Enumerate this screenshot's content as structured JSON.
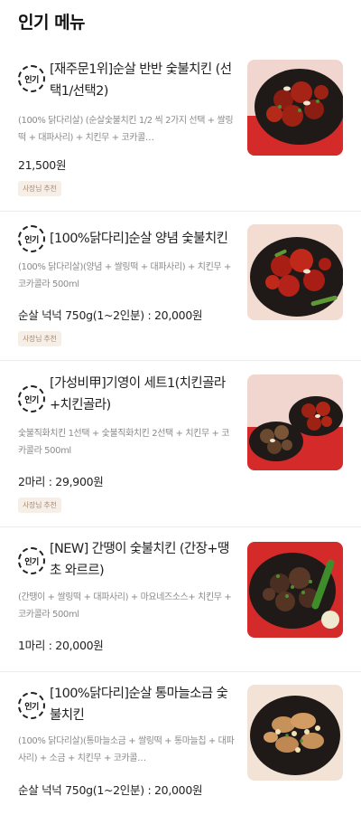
{
  "section": {
    "title": "인기 메뉴"
  },
  "items": [
    {
      "badge": "인기",
      "name": "[재주문1위]순살 반반 숯불치킨 (선택1/선택2)",
      "description": "(100% 닭다리살) (순살숯불치킨 1/2 씩 2가지 선택 + 쌀링떡 + 대파사리) + 치킨무 + 코카콜…",
      "price": "21,500원",
      "tag": "사장님 추천",
      "image_icon": "chicken-platter-red-icon"
    },
    {
      "badge": "인기",
      "name": "[100%닭다리]순살 양념 숯불치킨",
      "description": "(100% 닭다리살)(양념 + 쌀링떡 + 대파사리) + 치킨무 + 코카콜라 500ml",
      "price": "순살 넉넉 750g(1~2인분) : 20,000원",
      "tag": "사장님 추천",
      "image_icon": "spicy-chicken-icon"
    },
    {
      "badge": "인기",
      "name": "[가성비甲]기영이 세트1(치킨골라+치킨골라)",
      "description": "숯불직화치킨 1선택 + 숯불직화치킨 2선택 + 치킨무 + 코카콜라 500ml",
      "price": "2마리 : 29,900원",
      "tag": "사장님 추천",
      "image_icon": "chicken-set-icon"
    },
    {
      "badge": "인기",
      "name": "[NEW] 간땡이 숯불치킨 (간장+땡초 와르르)",
      "description": "(간땡이 + 쌀링떡 + 대파사리) + 마요네즈소스+ 치킨무 + 코카콜라 500ml",
      "price": "1마리 : 20,000원",
      "tag": "",
      "image_icon": "soy-chicken-icon"
    },
    {
      "badge": "인기",
      "name": "[100%닭다리]순살 통마늘소금 숯불치킨",
      "description": "(100% 닭다리살)(통마늘소금 + 쌀링떡 + 통마늘칩 + 대파사리) + 소금 + 치킨무 + 코카콜…",
      "price": "순살 넉넉 750g(1~2인분) : 20,000원",
      "tag": "",
      "image_icon": "garlic-salt-chicken-icon"
    }
  ],
  "colors": {
    "red_background": "#d42a2a",
    "dark_plate": "#1f1a18",
    "tag_text": "#b08a6a",
    "tag_bg": "#f6efe8"
  }
}
